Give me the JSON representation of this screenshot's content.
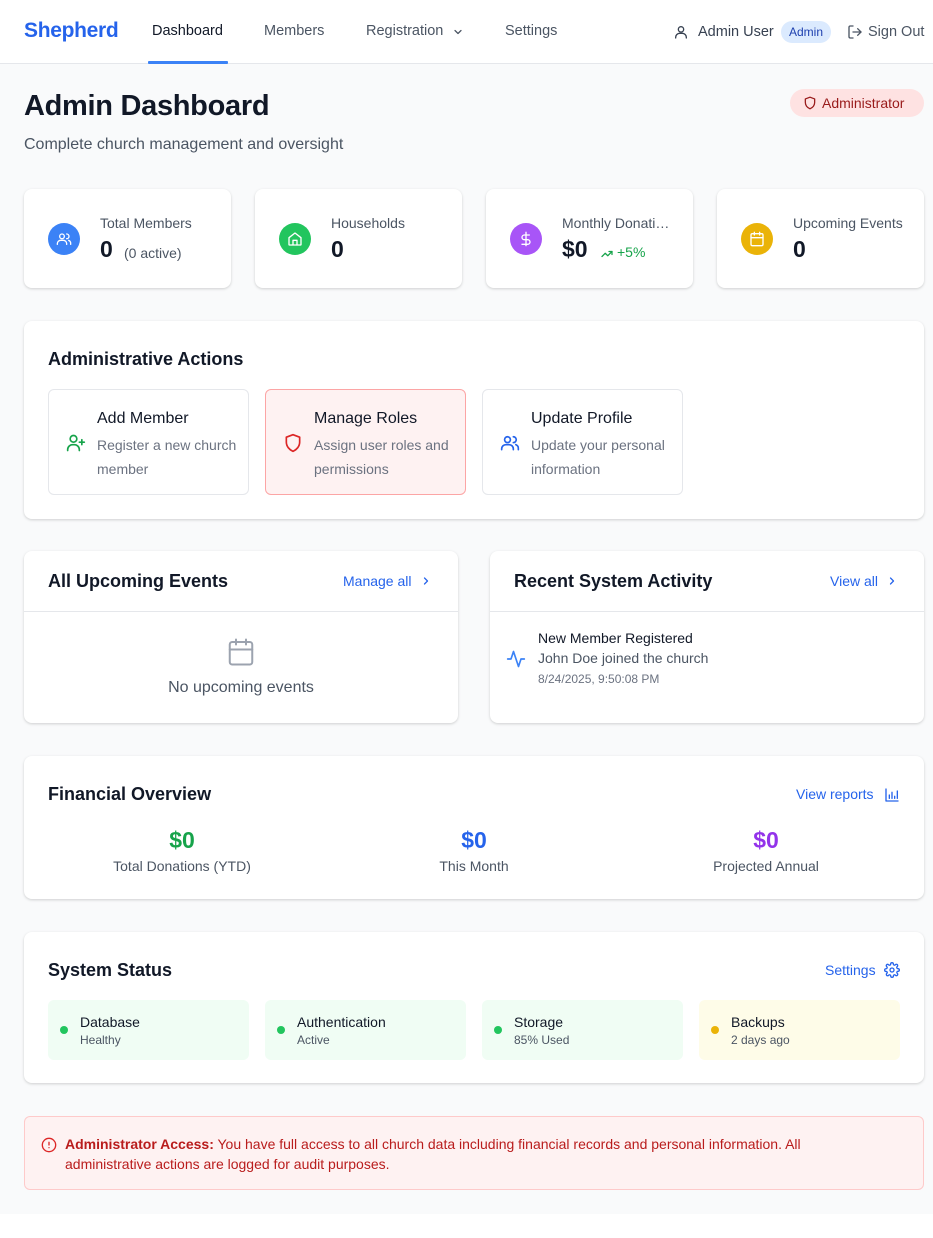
{
  "nav": {
    "brand": "Shepherd",
    "links": [
      "Dashboard",
      "Members",
      "Registration",
      "Settings"
    ],
    "active": "Dashboard",
    "user_name": "Admin User",
    "user_role": "Admin",
    "sign_out": "Sign Out"
  },
  "header": {
    "title": "Admin Dashboard",
    "subtitle": "Complete church management and oversight",
    "badge": "Administrator"
  },
  "stats": [
    {
      "label": "Total Members",
      "value": "0",
      "sub": "(0 active)",
      "icon": "users-icon",
      "color": "#3b82f6"
    },
    {
      "label": "Households",
      "value": "0",
      "icon": "home-icon",
      "color": "#22c55e"
    },
    {
      "label": "Monthly Donations",
      "value": "$0",
      "trend": "+5%",
      "icon": "dollar-icon",
      "color": "#a855f7"
    },
    {
      "label": "Upcoming Events",
      "value": "0",
      "icon": "calendar-icon",
      "color": "#eab308"
    }
  ],
  "admin_actions": {
    "title": "Administrative Actions",
    "items": [
      {
        "title": "Add Member",
        "desc": "Register a new church member",
        "icon": "user-plus-icon"
      },
      {
        "title": "Manage Roles",
        "desc": "Assign user roles and permissions",
        "icon": "shield-icon"
      },
      {
        "title": "Update Profile",
        "desc": "Update your personal information",
        "icon": "users-icon"
      }
    ]
  },
  "events": {
    "title": "All Upcoming Events",
    "link": "Manage all",
    "empty": "No upcoming events"
  },
  "activity": {
    "title": "Recent System Activity",
    "link": "View all",
    "items": [
      {
        "title": "New Member Registered",
        "desc": "John Doe joined the church",
        "time": "8/24/2025, 9:50:08 PM"
      }
    ]
  },
  "financial": {
    "title": "Financial Overview",
    "link": "View reports",
    "items": [
      {
        "value": "$0",
        "label": "Total Donations (YTD)",
        "color": "#16a34a"
      },
      {
        "value": "$0",
        "label": "This Month",
        "color": "#2563eb"
      },
      {
        "value": "$0",
        "label": "Projected Annual",
        "color": "#9333ea"
      }
    ]
  },
  "system_status": {
    "title": "System Status",
    "link": "Settings",
    "items": [
      {
        "name": "Database",
        "value": "Healthy",
        "state": "ok"
      },
      {
        "name": "Authentication",
        "value": "Active",
        "state": "ok"
      },
      {
        "name": "Storage",
        "value": "85% Used",
        "state": "ok"
      },
      {
        "name": "Backups",
        "value": "2 days ago",
        "state": "warn"
      }
    ]
  },
  "alert": {
    "label": "Administrator Access:",
    "text": " You have full access to all church data including financial records and personal information. All administrative actions are logged for audit purposes."
  }
}
